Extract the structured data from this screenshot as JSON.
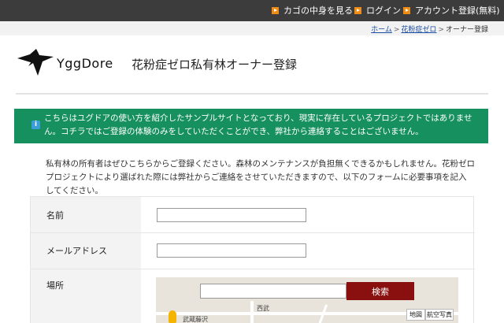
{
  "topnav": {
    "items": [
      {
        "label": "カゴの中身を見る"
      },
      {
        "label": "ログイン"
      },
      {
        "label": "アカウント登録(無料)"
      }
    ]
  },
  "breadcrumb": {
    "home": "ホーム",
    "sep1": ">",
    "section": "花粉症ゼロ",
    "sep2": ">",
    "current": "オーナー登録"
  },
  "logo": {
    "text": "YggDore"
  },
  "page": {
    "title": "花粉症ゼロ私有林オーナー登録"
  },
  "notice": {
    "icon": "info-icon",
    "text": "こちらはユグドアの使い方を紹介したサンプルサイトとなっており、現実に存在しているプロジェクトではありません。コチラではご登録の体験のみをしていただくことができ、弊社から連絡することはございません。"
  },
  "intro": {
    "text": "私有林の所有者はぜひこちらからご登録ください。森林のメンテナンスが負担無くできるかもしれません。花粉ゼロプロジェクトにより選ばれた際には弊社からご連絡をさせていただきますので、以下のフォームに必要事項を記入してください。"
  },
  "form": {
    "name_label": "名前",
    "name_value": "",
    "email_label": "メールアドレス",
    "email_value": "",
    "location_label": "場所",
    "map": {
      "search_value": "",
      "search_button": "検索",
      "place_label": "武蔵藤沢",
      "area_label": "西武",
      "type_map": "地図",
      "type_satellite": "航空写真"
    }
  },
  "colors": {
    "topbar": "#3c3c3c",
    "notice_bg": "#16905e",
    "search_button": "#8a0f0f",
    "arrow_icon": "#f08c14"
  }
}
